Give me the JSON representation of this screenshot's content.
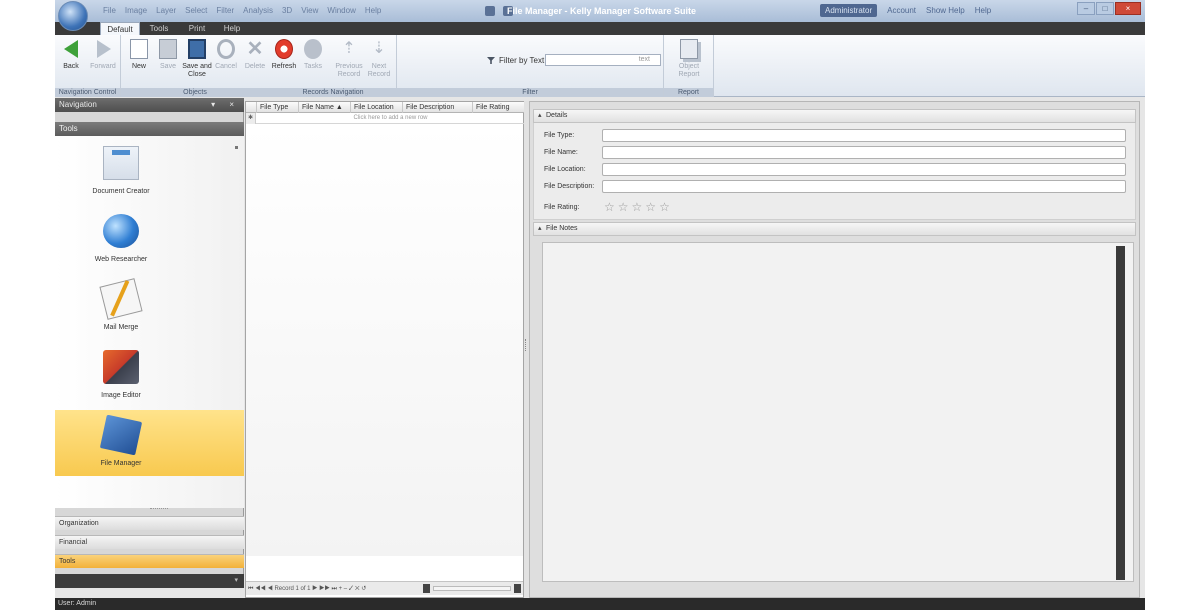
{
  "titlebar": {
    "menu": [
      "File",
      "Image",
      "Layer",
      "Select",
      "Filter",
      "Analysis",
      "3D",
      "View",
      "Window",
      "Help"
    ],
    "title": "File Manager - Kelly Manager Software Suite",
    "user_chip": "Administrator",
    "right_items": [
      "Account",
      "Show Help"
    ],
    "help_label": "Help"
  },
  "ribbon_tabs": [
    "Default",
    "Tools",
    "Print",
    "Help"
  ],
  "ribbon": {
    "buttons": [
      {
        "label": "Back",
        "icon": "back-arrow-icon"
      },
      {
        "label": "Forward",
        "icon": "forward-arrow-icon"
      },
      {
        "label": "New",
        "icon": "new-document-icon"
      },
      {
        "label": "Save",
        "icon": "save-icon"
      },
      {
        "label": "Save and Close",
        "icon": "save-close-icon"
      },
      {
        "label": "Cancel",
        "icon": "cancel-icon"
      },
      {
        "label": "Delete",
        "icon": "delete-icon"
      },
      {
        "label": "Refresh",
        "icon": "refresh-icon"
      },
      {
        "label": "Tasks",
        "icon": "gears-icon"
      },
      {
        "label": "Previous Record",
        "icon": "previous-record-icon"
      },
      {
        "label": "Next Record",
        "icon": "next-record-icon"
      },
      {
        "label": "Object Report",
        "icon": "report-icon"
      }
    ],
    "groups": [
      "Navigation Control",
      "Objects",
      "Records Navigation",
      "Filter",
      "Report"
    ],
    "filter_label": "Filter by Text",
    "filter_placeholder": "text"
  },
  "nav": {
    "title": "Navigation",
    "controls": "▾ ×",
    "section": "Tools",
    "tools": [
      {
        "label": "Document Creator",
        "icon": "document-creator-icon"
      },
      {
        "label": "Web Researcher",
        "icon": "web-researcher-icon"
      },
      {
        "label": "Mail Merge",
        "icon": "mail-merge-icon"
      },
      {
        "label": "Image Editor",
        "icon": "image-editor-icon"
      },
      {
        "label": "File Manager",
        "icon": "file-manager-icon"
      }
    ],
    "bottom": [
      "Organization",
      "Financial",
      "Tools"
    ]
  },
  "grid": {
    "columns": [
      "File Type",
      "File Name",
      "File Location",
      "File Description",
      "File Rating"
    ],
    "new_row_text": "Click here to add a new row",
    "record_text": "Record 1 of 1"
  },
  "details": {
    "section_title": "Details",
    "fields": [
      "File Type:",
      "File Name:",
      "File Location:",
      "File Description:"
    ],
    "rating_label": "File Rating:",
    "rating": 0,
    "rating_max": 5,
    "notes_title": "File Notes"
  },
  "status": {
    "text": "User: Admin"
  }
}
